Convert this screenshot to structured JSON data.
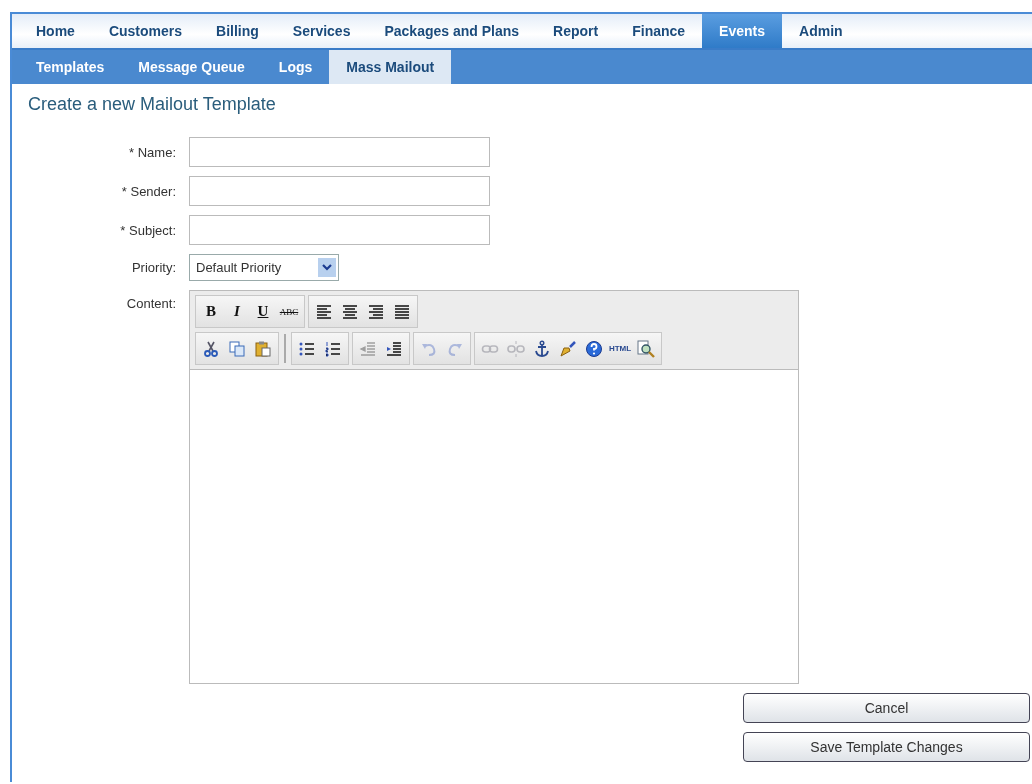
{
  "main_nav": [
    {
      "label": "Home",
      "selected": false
    },
    {
      "label": "Customers",
      "selected": false
    },
    {
      "label": "Billing",
      "selected": false
    },
    {
      "label": "Services",
      "selected": false
    },
    {
      "label": "Packages and Plans",
      "selected": false
    },
    {
      "label": "Report",
      "selected": false
    },
    {
      "label": "Finance",
      "selected": false
    },
    {
      "label": "Events",
      "selected": true
    },
    {
      "label": "Admin",
      "selected": false
    }
  ],
  "sub_nav": [
    {
      "label": "Templates",
      "selected": false
    },
    {
      "label": "Message Queue",
      "selected": false
    },
    {
      "label": "Logs",
      "selected": false
    },
    {
      "label": "Mass Mailout",
      "selected": true
    }
  ],
  "page_title": "Create a new Mailout Template",
  "fields": [
    {
      "label": "* Name:",
      "kind": "text"
    },
    {
      "label": "* Sender:",
      "kind": "text"
    },
    {
      "label": "* Subject:",
      "kind": "text"
    },
    {
      "label": "Priority:",
      "kind": "select",
      "value": "Default Priority"
    }
  ],
  "editor": {
    "label": "Content:",
    "toolbar": [
      [
        [
          {
            "kind": "bold",
            "label": "B",
            "disabled": false
          },
          {
            "kind": "italic",
            "label": "I",
            "disabled": false
          },
          {
            "kind": "underline",
            "label": "U",
            "disabled": false
          },
          {
            "kind": "strike",
            "label": "ABC",
            "disabled": false
          }
        ],
        [
          {
            "kind": "align-left",
            "disabled": false
          },
          {
            "kind": "align-center",
            "disabled": false
          },
          {
            "kind": "align-right",
            "disabled": false
          },
          {
            "kind": "justify",
            "disabled": false
          }
        ]
      ],
      [
        [
          {
            "kind": "cut",
            "disabled": false
          },
          {
            "kind": "copy",
            "disabled": false
          },
          {
            "kind": "paste",
            "disabled": false
          }
        ],
        [
          {
            "kind": "bullets",
            "disabled": false
          },
          {
            "kind": "numbers",
            "disabled": false
          }
        ],
        [
          {
            "kind": "outdent",
            "disabled": true
          },
          {
            "kind": "indent",
            "disabled": false
          }
        ],
        [
          {
            "kind": "undo",
            "disabled": true
          },
          {
            "kind": "redo",
            "disabled": true
          }
        ],
        [
          {
            "kind": "link",
            "disabled": true
          },
          {
            "kind": "unlink",
            "disabled": true
          },
          {
            "kind": "anchor",
            "disabled": false
          },
          {
            "kind": "cleanup",
            "disabled": false
          },
          {
            "kind": "help",
            "disabled": false
          },
          {
            "kind": "html",
            "label": "HTML",
            "disabled": false
          },
          {
            "kind": "preview",
            "disabled": false
          }
        ]
      ]
    ]
  },
  "buttons": [
    "Cancel",
    "Save Template Changes"
  ]
}
